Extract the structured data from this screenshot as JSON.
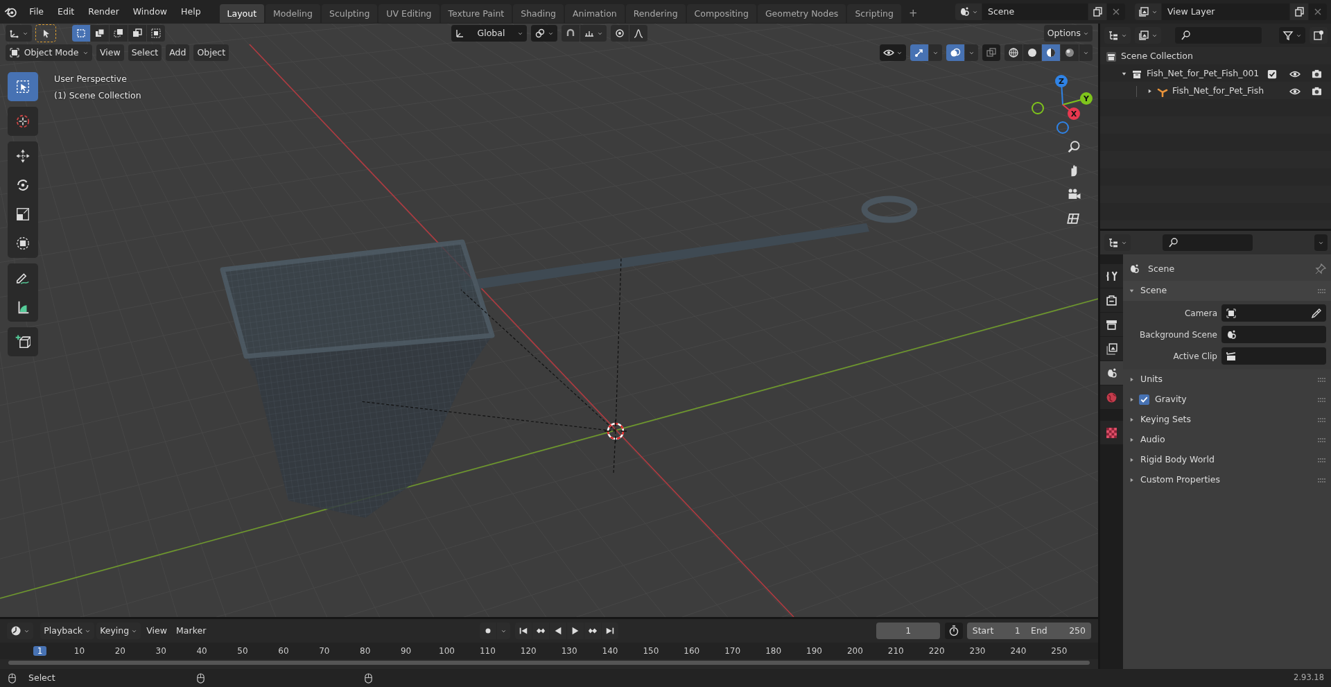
{
  "top_bar": {
    "menus": [
      "File",
      "Edit",
      "Render",
      "Window",
      "Help"
    ],
    "workspace_tabs": [
      {
        "label": "Layout",
        "selected": true
      },
      {
        "label": "Modeling",
        "selected": false
      },
      {
        "label": "Sculpting",
        "selected": false
      },
      {
        "label": "UV Editing",
        "selected": false
      },
      {
        "label": "Texture Paint",
        "selected": false
      },
      {
        "label": "Shading",
        "selected": false
      },
      {
        "label": "Animation",
        "selected": false
      },
      {
        "label": "Rendering",
        "selected": false
      },
      {
        "label": "Compositing",
        "selected": false
      },
      {
        "label": "Geometry Nodes",
        "selected": false
      },
      {
        "label": "Scripting",
        "selected": false
      }
    ],
    "add_tab": "+",
    "scene": "Scene",
    "view_layer": "View Layer"
  },
  "viewport": {
    "select_modes": [
      {
        "kind": "set",
        "selected": true
      },
      {
        "kind": "extend",
        "selected": false
      },
      {
        "kind": "subtract",
        "selected": false
      },
      {
        "kind": "difference",
        "selected": false
      },
      {
        "kind": "intersect",
        "selected": false
      }
    ],
    "orientation": "Global",
    "options": "Options",
    "mode": "Object Mode",
    "menus": [
      "View",
      "Select",
      "Add",
      "Object"
    ],
    "shading_modes": [
      {
        "kind": "wireframe",
        "selected": false
      },
      {
        "kind": "solid",
        "selected": false
      },
      {
        "kind": "material",
        "selected": true
      },
      {
        "kind": "rendered",
        "selected": false
      }
    ],
    "overlay_text": [
      "User Perspective",
      "(1) Scene Collection"
    ],
    "tool_groups": [
      {
        "tools": [
          {
            "kind": "select",
            "selected": true
          }
        ]
      },
      {
        "tools": [
          {
            "kind": "cursor",
            "selected": false
          }
        ]
      },
      {
        "tools": [
          {
            "kind": "move",
            "selected": false
          },
          {
            "kind": "rotate",
            "selected": false
          },
          {
            "kind": "scale",
            "selected": false
          },
          {
            "kind": "transform",
            "selected": false
          }
        ]
      },
      {
        "tools": [
          {
            "kind": "annotate",
            "selected": false
          },
          {
            "kind": "measure",
            "selected": false
          }
        ]
      },
      {
        "tools": [
          {
            "kind": "add-cube",
            "selected": false
          }
        ]
      }
    ],
    "gizmo_axes": [
      {
        "label": "Z",
        "color": "#2f83e6"
      },
      {
        "label": "Y",
        "color": "#7fc41c"
      },
      {
        "label": "X",
        "color": "#e8384f"
      }
    ]
  },
  "outliner": {
    "tree": [
      {
        "label": "Scene Collection",
        "kind": "scene",
        "children": [
          {
            "label": "Fish_Net_for_Pet_Fish_001",
            "kind": "collection",
            "expanded": true,
            "checked": true,
            "children": [
              {
                "label": "Fish_Net_for_Pet_Fish",
                "kind": "object",
                "expanded": false
              }
            ]
          }
        ]
      }
    ]
  },
  "properties": {
    "tabs": [
      {
        "kind": "tool",
        "selected": false
      },
      {
        "kind": "render",
        "selected": false
      },
      {
        "kind": "output",
        "selected": false
      },
      {
        "kind": "view-layer",
        "selected": false
      },
      {
        "kind": "scene",
        "selected": true
      },
      {
        "kind": "world",
        "selected": false
      },
      {
        "kind": "texture",
        "selected": false
      }
    ],
    "title": "Scene",
    "panels": [
      {
        "label": "Scene",
        "expanded": true,
        "fields": [
          {
            "label": "Camera",
            "kind": "camera"
          },
          {
            "label": "Background Scene",
            "kind": "scene"
          },
          {
            "label": "Active Clip",
            "kind": "clip"
          }
        ]
      },
      {
        "label": "Units",
        "expanded": false
      },
      {
        "label": "Gravity",
        "expanded": false,
        "checkbox": {
          "checked": true
        }
      },
      {
        "label": "Keying Sets",
        "expanded": false
      },
      {
        "label": "Audio",
        "expanded": false
      },
      {
        "label": "Rigid Body World",
        "expanded": false
      },
      {
        "label": "Custom Properties",
        "expanded": false
      }
    ]
  },
  "timeline": {
    "menus": [
      "Playback",
      "Keying",
      "View",
      "Marker"
    ],
    "current_frame": "1",
    "start_label": "Start",
    "start": "1",
    "end_label": "End",
    "end": "250",
    "ruler": {
      "current": "1",
      "labels": [
        "10",
        "20",
        "30",
        "40",
        "50",
        "60",
        "70",
        "80",
        "90",
        "100",
        "110",
        "120",
        "130",
        "140",
        "150",
        "160",
        "170",
        "180",
        "190",
        "200",
        "210",
        "220",
        "230",
        "240",
        "250"
      ]
    }
  },
  "status_bar": {
    "action": "Select",
    "version": "2.93.18"
  }
}
